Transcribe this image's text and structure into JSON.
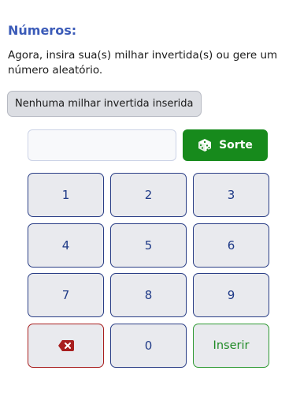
{
  "section": {
    "title": "Números:",
    "description": "Agora, insira sua(s) milhar invertida(s) ou gere um número aleatório.",
    "status_tag": "Nenhuma milhar invertida inserida"
  },
  "entry": {
    "value": "",
    "placeholder": ""
  },
  "sorte_button": {
    "label": "Sorte",
    "icon": "dice-icon"
  },
  "keypad": {
    "keys": [
      "1",
      "2",
      "3",
      "4",
      "5",
      "6",
      "7",
      "8",
      "9"
    ],
    "zero": "0",
    "delete_icon": "backspace-icon",
    "insert_label": "Inserir"
  },
  "colors": {
    "title": "#3b5bb8",
    "sorte_bg": "#178a1c",
    "key_border": "#2a3e86",
    "key_text": "#1f3a87",
    "delete_accent": "#a81e1e",
    "insert_accent": "#2f9a34"
  }
}
